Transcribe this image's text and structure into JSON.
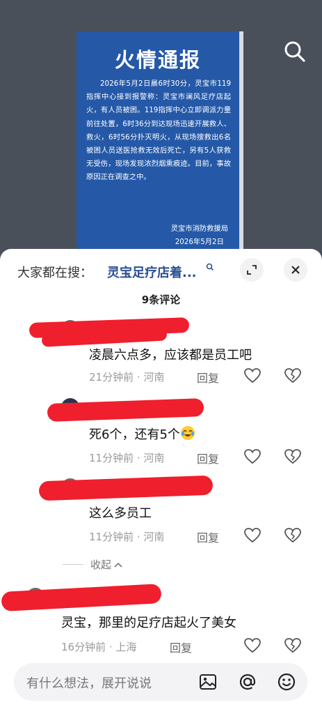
{
  "notice": {
    "title": "火情通报",
    "body": "2026年5月2日晨6时30分，灵宝市119指挥中心接到报警称：灵宝市澜风足疗店起火，有人员被困。119指挥中心立即调派力量前往处置，6时36分到达现场迅速开展救人、救火，6时56分扑灭明火，从现场搜救出6名被困人员送医抢救无效后死亡，另有5人获救无受伤，现场发现浓烈烟熏痕迹。目前，事故原因正在调查之中。",
    "org": "灵宝市消防救援局",
    "date": "2026年5月2日"
  },
  "search_icon": "search-icon",
  "sheet": {
    "hot_label": "大家都在搜：",
    "hot_query": "灵宝足疗店着...",
    "comment_count": "9条评论"
  },
  "comments": [
    {
      "text": "凌晨六点多，应该都是员工吧",
      "time": "21分钟前",
      "location": "河南",
      "reply": "回复"
    },
    {
      "text": "死6个，还有5个",
      "emoji": "crying-laughing-emoji",
      "time": "11分钟前",
      "location": "河南",
      "reply": "回复"
    },
    {
      "text": "这么多员工",
      "time": "11分钟前",
      "location": "河南",
      "reply": "回复"
    },
    {
      "text": "灵宝，那里的足疗店起火了美女",
      "time": "16分钟前",
      "location": "上海",
      "reply": "回复"
    }
  ],
  "collapse_label": "收起",
  "input": {
    "placeholder": "有什么想法，展开说说"
  },
  "colors": {
    "notice_bg": "#2559a8",
    "redaction": "#ef1f2d",
    "link": "#2c4f94"
  }
}
